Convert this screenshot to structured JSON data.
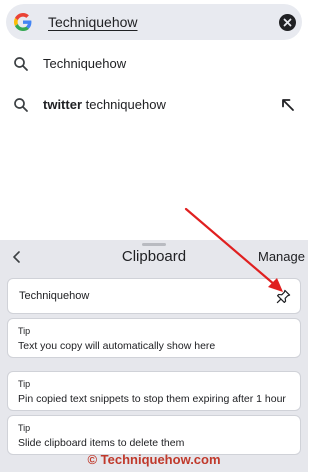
{
  "search": {
    "query": "Techniquehow",
    "logo_icon": "google-g-icon",
    "clear_icon": "close-circle-icon"
  },
  "suggestions": [
    {
      "bold": "",
      "text": "Techniquehow",
      "icon": "search-icon"
    },
    {
      "bold": "twitter",
      "text": " techniquehow",
      "icon": "search-icon",
      "action_icon": "fill-query-arrow-icon"
    }
  ],
  "clipboard": {
    "title": "Clipboard",
    "back_icon": "chevron-left-icon",
    "manage_label": "Manage",
    "items": [
      {
        "text": "Techniquehow",
        "pin_icon": "pin-icon"
      }
    ],
    "tips": [
      {
        "label": "Tip",
        "text": "Text you copy will automatically show here"
      },
      {
        "label": "Tip",
        "text": "Pin copied text snippets to stop them expiring after 1 hour"
      },
      {
        "label": "Tip",
        "text": "Slide clipboard items to delete them"
      }
    ]
  },
  "watermark": "© Techniquehow.com",
  "colors": {
    "search_bg": "#e8eaf0",
    "panel_bg": "#e6e7ec",
    "annotation_red": "#e02020",
    "watermark_red": "#c0392b"
  }
}
